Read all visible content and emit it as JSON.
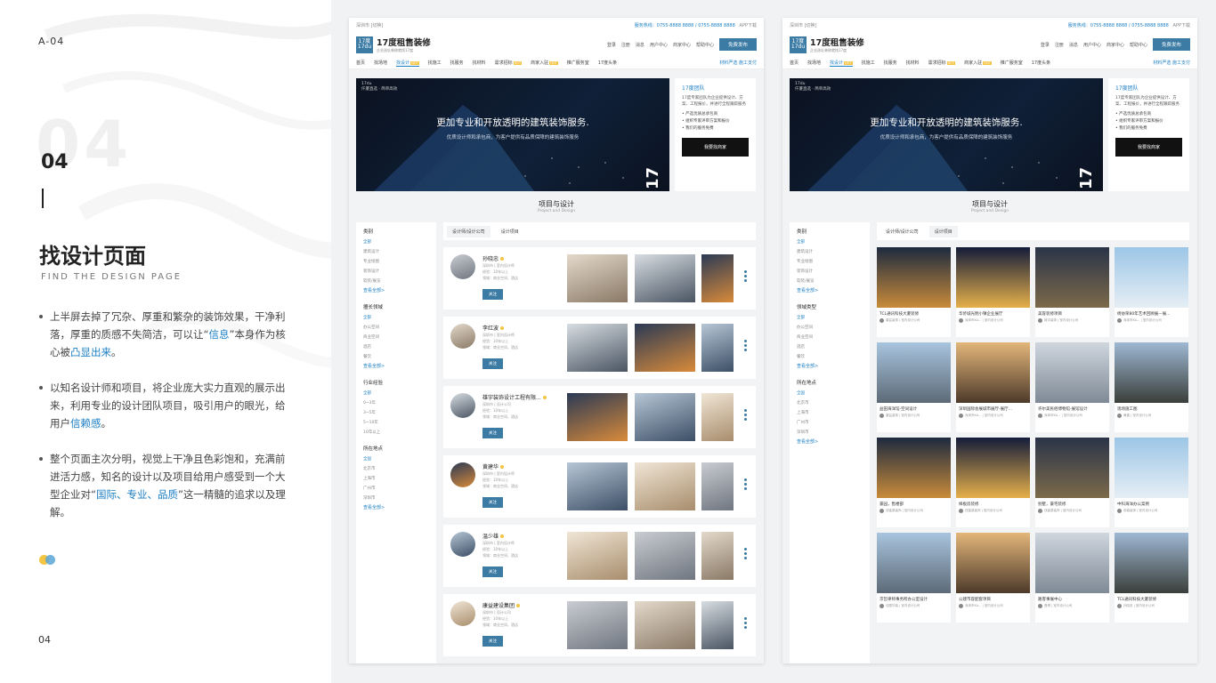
{
  "left": {
    "code": "A-04",
    "num": "04",
    "title": "找设计页面",
    "subtitle": "FIND THE DESIGN PAGE",
    "bullets": [
      {
        "pre": "上半屏去掉了冗杂、厚重和繁杂的装饰效果，干净利落，厚重的质感不失简洁，可以让“",
        "hl": "信息",
        "mid": "”本身作为核心被",
        "hl2": "凸显出来",
        "post": "。"
      },
      {
        "pre": "以知名设计师和项目，将企业庞大实力直观的展示出来，利用专业的设计团队项目，吸引用户的眼光，给用户",
        "hl": "信赖感",
        "mid": "",
        "hl2": "",
        "post": "。"
      },
      {
        "pre": "整个页面主次分明，视觉上干净且色彩饱和，充满前进活力感，知名的设计以及项目给用户感受到一个大型企业对“",
        "hl": "国际、专业、品质",
        "mid": "”这一精髓的追求以及理解",
        "hl2": "",
        "post": "。"
      }
    ],
    "page": "04"
  },
  "site": {
    "city": "深圳市 [切换]",
    "phone": "服务热线：0755-8888 8888 / 0755-8888 8888",
    "app": "APP下载",
    "logo_mark": "17度\n17du",
    "logo_name": "17度租售装修",
    "logo_slogan": "企业选址装修就找17度",
    "header_links": [
      "登录",
      "注册",
      "消息",
      "用户中心",
      "商家中心",
      "帮助中心"
    ],
    "free_btn": "免费发布",
    "nav": [
      "首页",
      "找场地",
      "找设计",
      "找施工",
      "找服务",
      "找材料",
      "需求招标",
      "商家入驻",
      "推广服务室",
      "17度头条"
    ],
    "nav_right": "材料严选  施工支付",
    "banner": {
      "brand": "17du\n仟厦直选 · 简单高效",
      "headline": "更加专业和开放透明的建筑装饰服务.",
      "sub": "优质设计师和承包商，为客户提供有品质保障的建筑装饰服务",
      "big": "17"
    },
    "team": {
      "title": "17度团队",
      "desc": "17度专家团队为企业提供设计、方案、工程报价，并进行全程跟踪服务",
      "items": [
        "• 严选优质总承包商",
        "• 组织专家评审方案和报价",
        "• 我们的服务免费"
      ],
      "btn": "我要找商家"
    },
    "section": {
      "title": "项目与设计",
      "sub": "Project and Design"
    },
    "filters": [
      {
        "title": "类别",
        "options": [
          "全部",
          "建筑设计",
          "专业绘图",
          "装饰设计",
          "软装/展览"
        ],
        "more": "查看全部>"
      },
      {
        "title": "擅长领域",
        "options": [
          "全部",
          "办公空间",
          "商业空间",
          "酒店",
          "餐饮"
        ],
        "more": "查看全部>"
      },
      {
        "title": "行业经验",
        "options": [
          "全部",
          "0~3年",
          "3~5年",
          "5~10年",
          "10年以上"
        ],
        "more": ""
      },
      {
        "title": "所在地点",
        "options": [
          "全国",
          "北京市",
          "上海市",
          "广州市",
          "深圳市"
        ],
        "more": "查看全部>"
      }
    ],
    "filters2": [
      {
        "title": "类别",
        "options": [
          "全部",
          "建筑设计",
          "专业绘图",
          "装饰设计",
          "软装/展览"
        ],
        "more": "查看全部>"
      },
      {
        "title": "领域类型",
        "options": [
          "全部",
          "办公空间",
          "商业空间",
          "酒店",
          "餐饮"
        ],
        "more": "查看全部>"
      },
      {
        "title": "所在地点",
        "options": [
          "全国",
          "北京市",
          "上海市",
          "广州市",
          "深圳市"
        ],
        "more": "查看全部>"
      }
    ],
    "tabs": [
      "设计师/设计公司",
      "设计项目"
    ],
    "designers": [
      {
        "name": "孙晓忠",
        "l1": "深圳市 | 室内设计师",
        "l2": "经验：10年以上",
        "l3": "领域：商业空间、酒店",
        "follow": "关注"
      },
      {
        "name": "李红波",
        "l1": "深圳市 | 室内设计师",
        "l2": "经验：10年以上",
        "l3": "领域：商业空间、酒店",
        "follow": "关注"
      },
      {
        "name": "雄宇装饰设计工程有限...",
        "l1": "深圳市 | 设计公司",
        "l2": "经验：10年以上",
        "l3": "领域：商业空间、酒店",
        "follow": "关注"
      },
      {
        "name": "黄建华",
        "l1": "深圳市 | 室内设计师",
        "l2": "经验：10年以上",
        "l3": "领域：商业空间、酒店",
        "follow": "关注"
      },
      {
        "name": "温少雄",
        "l1": "深圳市 | 室内设计师",
        "l2": "经验：10年以上",
        "l3": "领域：商业空间、酒店",
        "follow": "关注"
      },
      {
        "name": "康益建设集团",
        "l1": "深圳市 | 设计公司",
        "l2": "经验：10年以上",
        "l3": "领域：商业空间、酒店",
        "follow": "关注"
      }
    ],
    "projects": [
      {
        "cap": "TCL通讯科技大厦装修",
        "au": "康益装饰 | 室内设计公司"
      },
      {
        "cap": "华侨城光明小镇企业展厅",
        "au": "深圳市KA... | 室内设计公司"
      },
      {
        "cap": "美容装修项目",
        "au": "雄宇装饰 | 室内设计公司"
      },
      {
        "cap": "杨协荣80年艺术回顾展—展...",
        "au": "深圳市KA... | 室内设计公司"
      },
      {
        "cap": "益田海洋馆-空间设计",
        "au": "康益装饰 | 室内设计公司"
      },
      {
        "cap": "深圳国际会展城市展厅-展厅...",
        "au": "深圳市KA... | 室内设计公司"
      },
      {
        "cap": "许尔美民俗博物馆-展馆设计",
        "au": "深圳市KA... | 室内设计公司"
      },
      {
        "cap": "现场施工图",
        "au": "黄建 | 室内设计公司"
      },
      {
        "cap": "豪园，售楼部",
        "au": "钱塞泉装饰 | 室内设计公司"
      },
      {
        "cap": "样板房装修",
        "au": "钱塞泉装饰 | 室内设计公司"
      },
      {
        "cap": "别墅，豪宅装修",
        "au": "钱塞泉装饰 | 室内设计公司"
      },
      {
        "cap": "中科海洋办公案例",
        "au": "帝森装饰 | 室内设计公司"
      },
      {
        "cap": "京哲律师事务所办公室设计",
        "au": "佳图华装 | 室内设计公司"
      },
      {
        "cap": "公建市容配套项目",
        "au": "深圳市KA... | 室内设计公司"
      },
      {
        "cap": "路客事展中心",
        "au": "蓬博 | 室内设计公司"
      },
      {
        "cap": "TCL通讯科技大厦装修",
        "au": "孙晓忠 | 室内设计公司"
      }
    ]
  },
  "colors": {
    "accent": "#3b7ba4",
    "link": "#1b7fc4",
    "gold": "#f4c443",
    "dark": "#111111"
  }
}
